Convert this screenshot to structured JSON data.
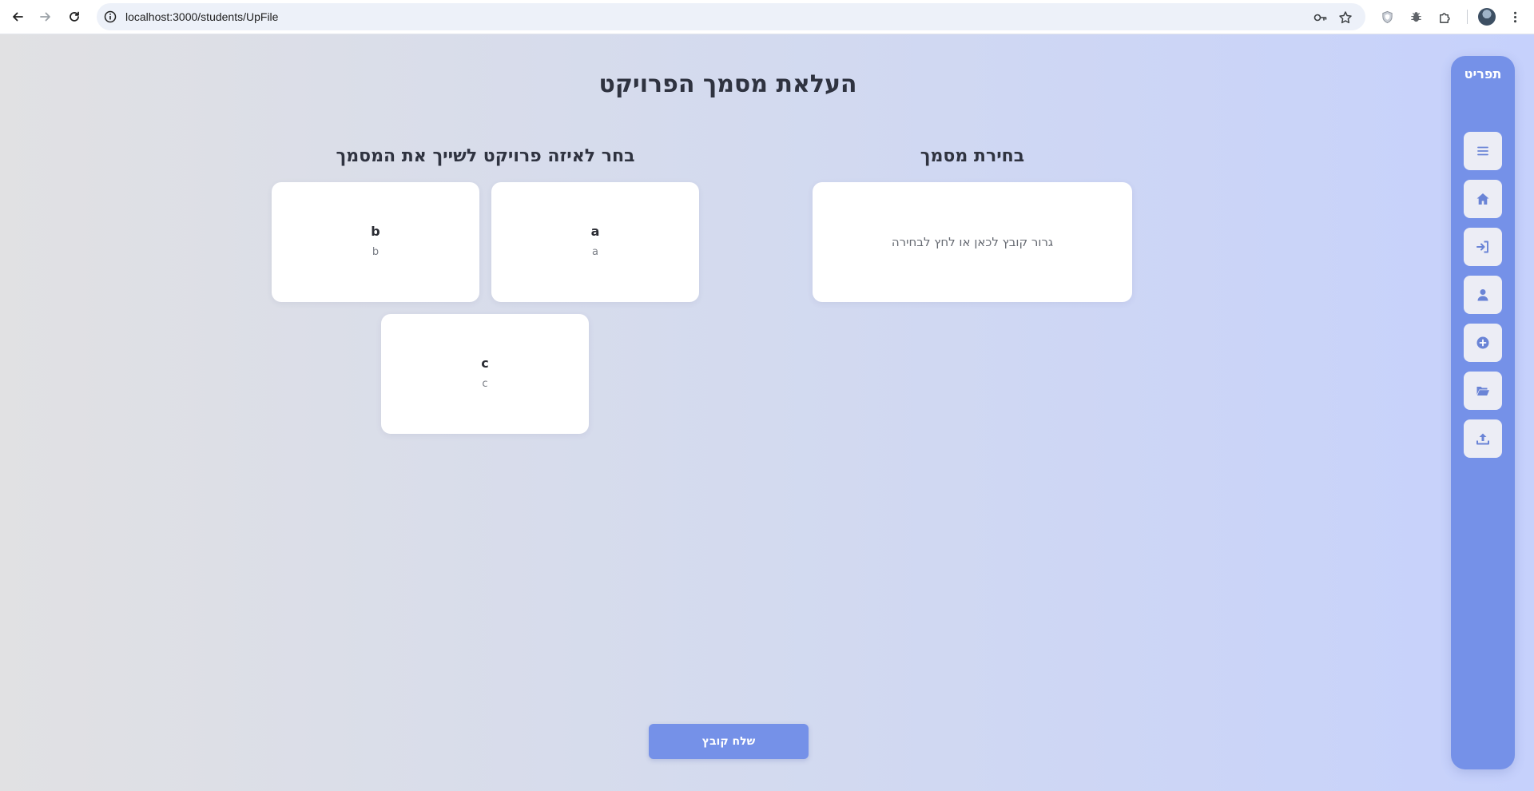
{
  "browser": {
    "url": "localhost:3000/students/UpFile",
    "nav": {
      "back": "back-arrow-icon",
      "forward": "forward-arrow-icon",
      "reload": "reload-icon"
    },
    "toolbar_icons": [
      "key-icon",
      "star-icon",
      "shield-extension-icon",
      "bug-extension-icon",
      "puzzle-icon",
      "avatar",
      "kebab-menu-icon"
    ]
  },
  "page": {
    "title": "העלאת מסמך הפרויקט"
  },
  "file_section": {
    "title": "בחירת מסמך",
    "dropzone_text": "גרור קובץ לכאן או לחץ לבחירה"
  },
  "project_section": {
    "title": "בחר לאיזה פרויקט לשייך את המסמך",
    "projects": [
      {
        "name": "a",
        "description": "a"
      },
      {
        "name": "b",
        "description": "b"
      },
      {
        "name": "c",
        "description": "c"
      }
    ]
  },
  "submit": {
    "label": "שלח קובץ"
  },
  "sidebar": {
    "logo": "תפריט",
    "items": [
      {
        "icon": "hamburger-menu-icon"
      },
      {
        "icon": "home-icon"
      },
      {
        "icon": "login-icon"
      },
      {
        "icon": "user-icon"
      },
      {
        "icon": "plus-circle-icon"
      },
      {
        "icon": "folder-open-icon"
      },
      {
        "icon": "upload-icon"
      }
    ]
  },
  "colors": {
    "accent": "#7591e8",
    "sidebar_button_bg": "#ecedf5",
    "text_dark": "#2f3340",
    "text_muted": "#666a72"
  }
}
